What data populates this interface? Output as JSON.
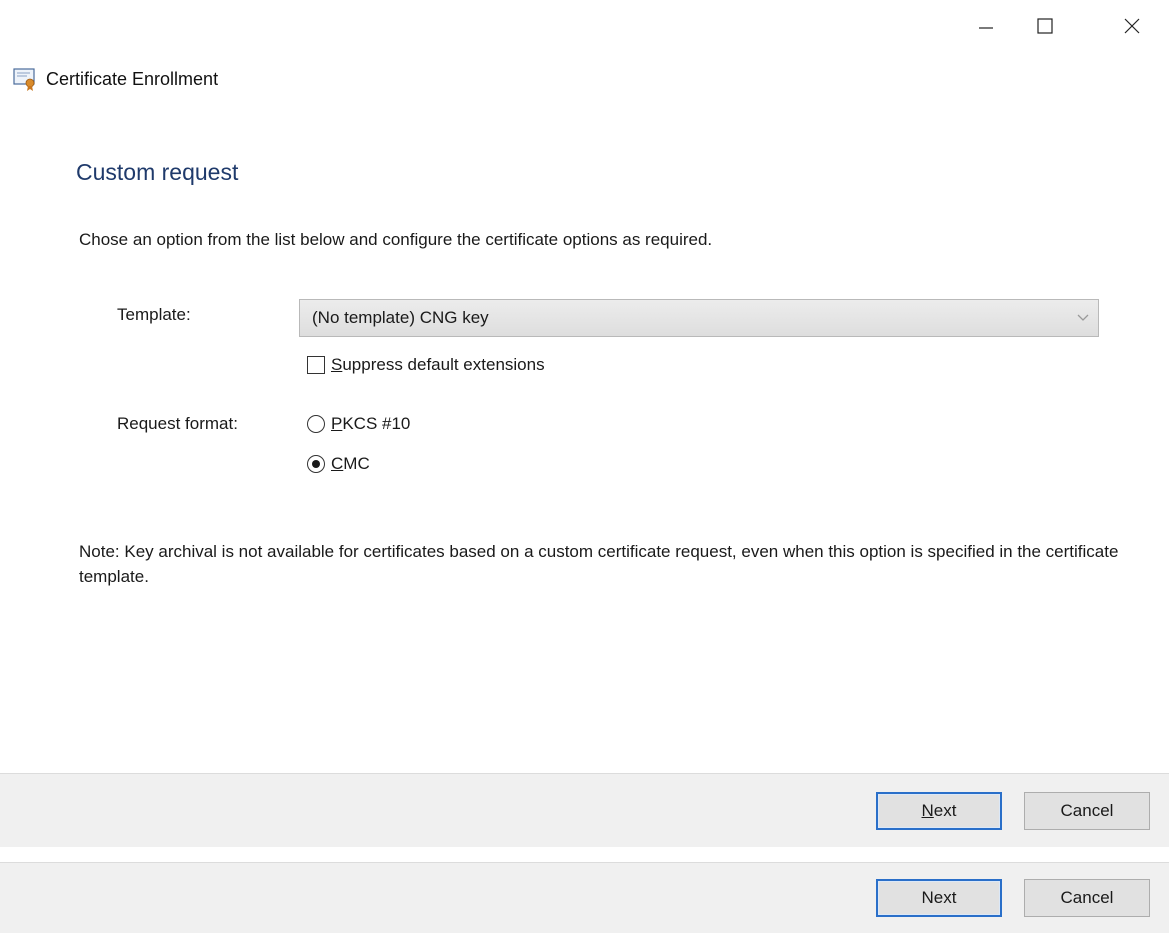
{
  "window": {
    "title": "Certificate Enrollment",
    "controls": {
      "minimize_icon": "minimize-icon",
      "maximize_icon": "maximize-icon",
      "close_icon": "close-icon"
    }
  },
  "page": {
    "heading": "Custom request",
    "instruction": "Chose an option from the list below and configure the certificate options as required."
  },
  "template": {
    "label": "Template:",
    "selected": "(No template) CNG key",
    "suppress_checkbox": {
      "access_key": "S",
      "label_rest": "uppress default extensions",
      "checked": false
    }
  },
  "request_format": {
    "label": "Request format:",
    "options": [
      {
        "access_key": "P",
        "label_rest": "KCS #10",
        "checked": false
      },
      {
        "access_key": "C",
        "label_rest": "MC",
        "checked": true
      }
    ]
  },
  "note": "Note: Key archival is not available for certificates based on a custom certificate request, even when this option is specified in the certificate template.",
  "footer": [
    {
      "next_access_key": "N",
      "next_rest": "ext",
      "cancel": "Cancel"
    },
    {
      "next": "Next",
      "cancel": "Cancel"
    }
  ],
  "colors": {
    "heading": "#1f3a6b",
    "default_button_border": "#2a6fc9",
    "footer_background": "#f0f0f0"
  }
}
